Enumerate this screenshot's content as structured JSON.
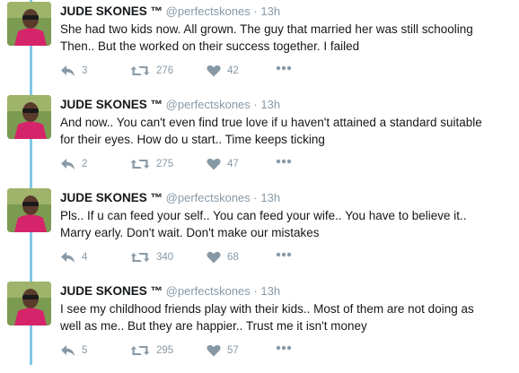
{
  "tweets": [
    {
      "name": "JUDE SKONES ™",
      "handle": "@perfectskones",
      "separator": "·",
      "time": "13h",
      "lines": [
        "She had two kids now.  All grown.  The guy that married her was still schooling",
        "Then..  But the worked on their success together.  I failed"
      ],
      "replies": "3",
      "retweets": "276",
      "likes": "42"
    },
    {
      "name": "JUDE SKONES ™",
      "handle": "@perfectskones",
      "separator": "·",
      "time": "13h",
      "lines": [
        "And now..  You can't even find true love if u haven't attained a standard suitable",
        "for their eyes.  How do u start..  Time keeps ticking"
      ],
      "replies": "2",
      "retweets": "275",
      "likes": "47"
    },
    {
      "name": "JUDE SKONES ™",
      "handle": "@perfectskones",
      "separator": "·",
      "time": "13h",
      "lines": [
        "Pls..  If u can feed your self..  You can feed your wife..  You have to believe it..",
        "Marry early.  Don't wait.   Don't make our mistakes"
      ],
      "replies": "4",
      "retweets": "340",
      "likes": "68"
    },
    {
      "name": "JUDE SKONES ™",
      "handle": "@perfectskones",
      "separator": "·",
      "time": "13h",
      "lines": [
        "I see my childhood friends play with their kids.. Most of them are not doing as",
        "well as me..  But they are happier.. Trust me it isn't money"
      ],
      "replies": "5",
      "retweets": "295",
      "likes": "57"
    }
  ],
  "colors": {
    "thread_line": "#7fc8e8",
    "meta_gray": "#8899a6",
    "text": "#14171a"
  },
  "icons": {
    "reply": "reply-icon",
    "retweet": "retweet-icon",
    "like": "heart-icon",
    "more": "more-dots-icon"
  }
}
